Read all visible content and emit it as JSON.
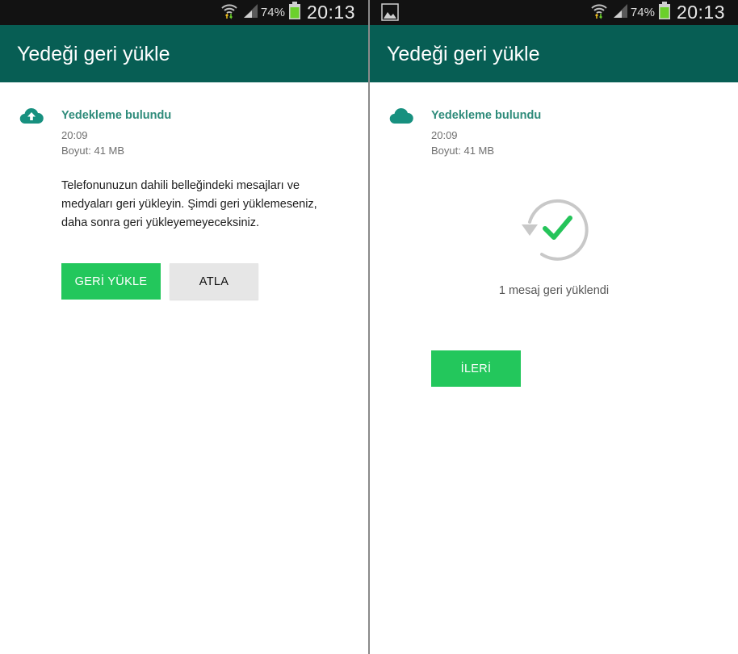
{
  "status_bar": {
    "battery_percent": "74%",
    "time": "20:13"
  },
  "screen_left": {
    "app_bar_title": "Yedeği geri yükle",
    "backup_title": "Yedekleme bulundu",
    "backup_time": "20:09",
    "backup_size": "Boyut: 41 MB",
    "description": "Telefonunuzun dahili belleğindeki mesajları ve medyaları geri yükleyin. Şimdi geri yüklemeseniz, daha sonra geri yükleyemeyeceksiniz.",
    "restore_button_label": "GERİ YÜKLE",
    "skip_button_label": "ATLA"
  },
  "screen_right": {
    "app_bar_title": "Yedeği geri yükle",
    "backup_title": "Yedekleme bulundu",
    "backup_time": "20:09",
    "backup_size": "Boyut: 41 MB",
    "result_text": "1 mesaj geri yüklendi",
    "next_button_label": "İLERİ"
  },
  "icons": {
    "status_bar": [
      "wifi-icon",
      "signal-icon",
      "battery-icon"
    ],
    "gallery_notification": "image-icon",
    "cloud_upload": "cloud-upload-icon",
    "cloud": "cloud-icon",
    "success": "restore-success-icon"
  },
  "colors": {
    "status_bar_bg": "#121212",
    "app_bar_bg": "#075e54",
    "accent_title": "#2e8b7a",
    "primary_button": "#23c75c",
    "secondary_button": "#e6e6e6",
    "check_green": "#25c45a",
    "battery_green": "#6bd02b"
  }
}
